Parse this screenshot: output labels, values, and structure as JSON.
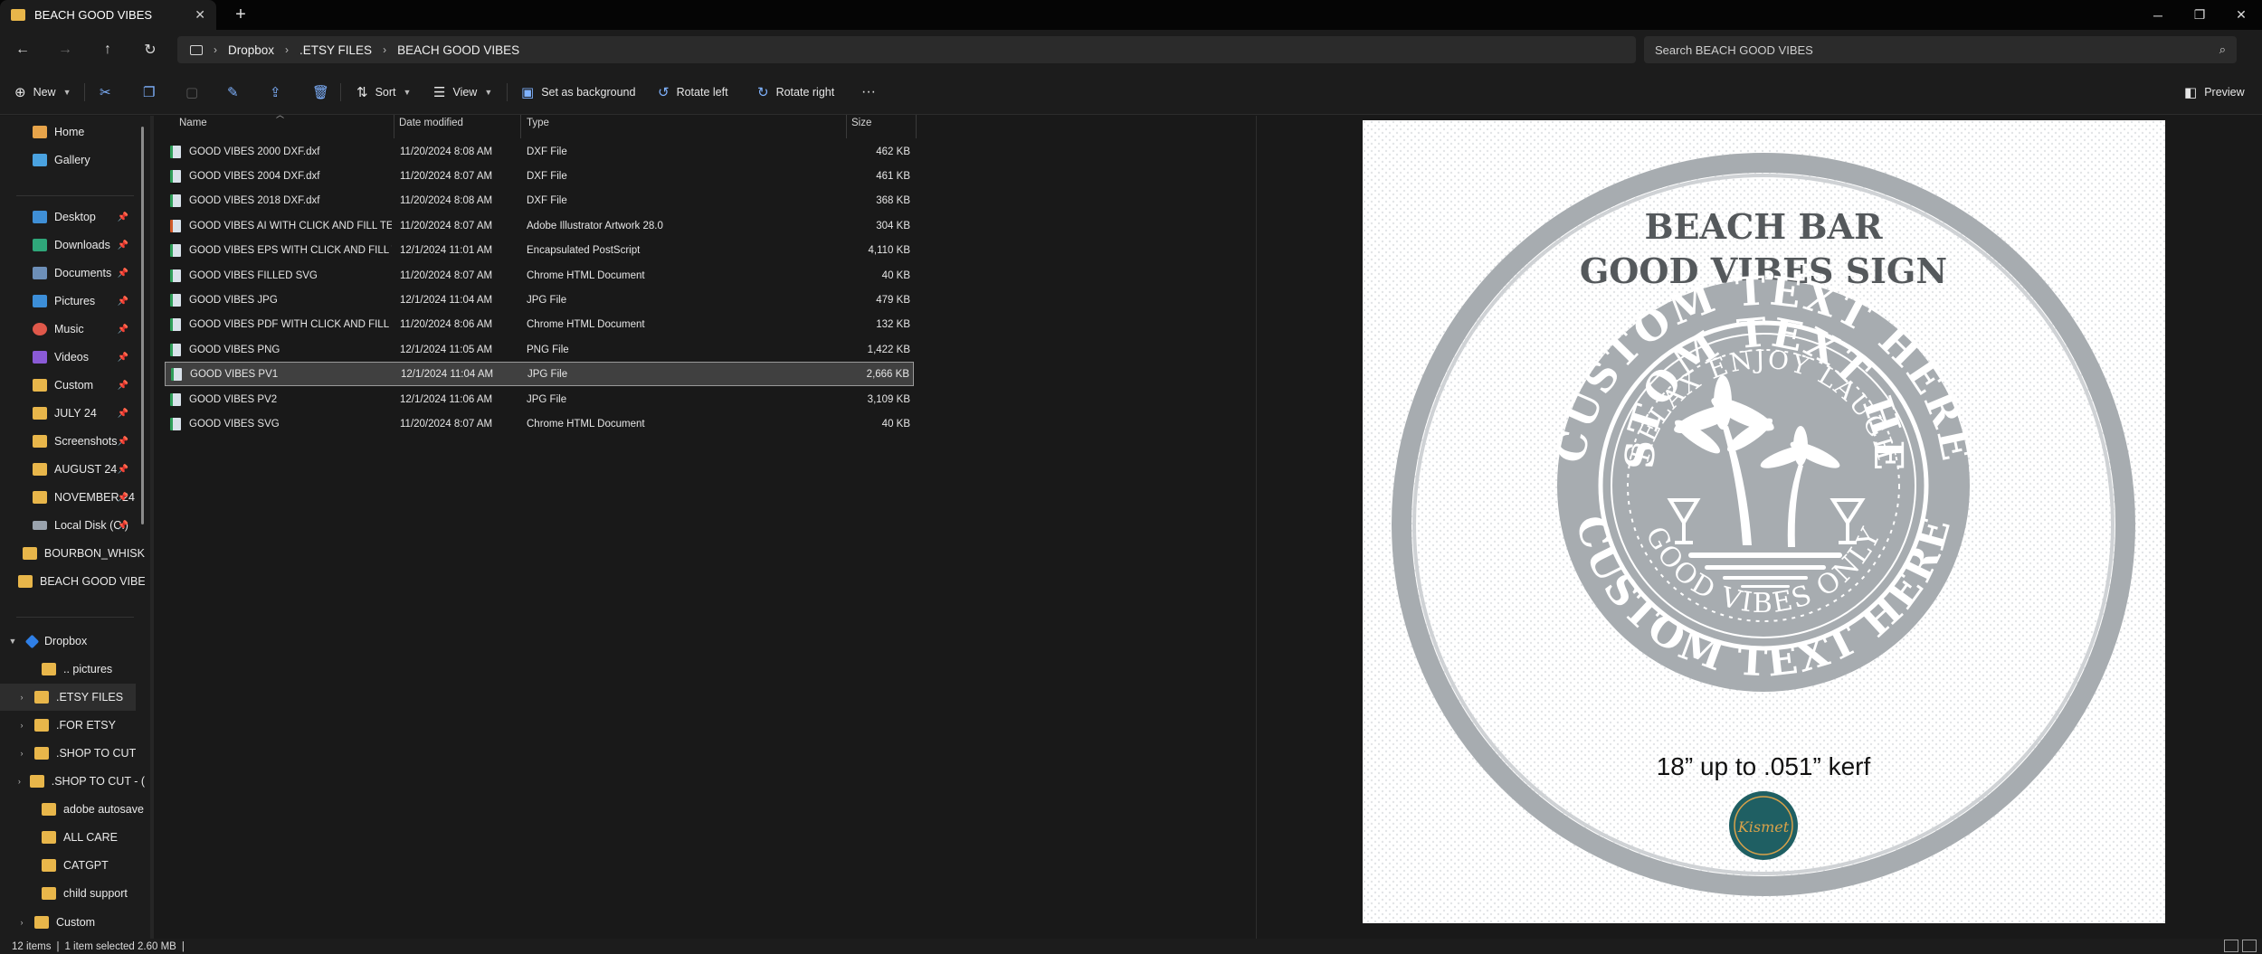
{
  "window": {
    "tab_title": "BEACH GOOD VIBES",
    "tab_close": "✕",
    "new_tab": "+"
  },
  "address": {
    "segments": [
      "Dropbox",
      ".ETSY FILES",
      "BEACH GOOD VIBES"
    ],
    "separator": "›"
  },
  "search": {
    "placeholder": "Search BEACH GOOD VIBES"
  },
  "toolbar": {
    "new_label": "New",
    "sort_label": "Sort",
    "view_label": "View",
    "set_background_label": "Set as background",
    "rotate_left_label": "Rotate left",
    "rotate_right_label": "Rotate right",
    "more_label": "···",
    "preview_label": "Preview"
  },
  "sidebar": {
    "items": [
      {
        "label": "Home"
      },
      {
        "label": "Gallery"
      },
      {
        "label": "Desktop"
      },
      {
        "label": "Downloads"
      },
      {
        "label": "Documents"
      },
      {
        "label": "Pictures"
      },
      {
        "label": "Music"
      },
      {
        "label": "Videos"
      },
      {
        "label": "Custom"
      },
      {
        "label": "JULY 24"
      },
      {
        "label": "Screenshots"
      },
      {
        "label": "AUGUST 24"
      },
      {
        "label": "NOVEMBER 24"
      },
      {
        "label": "Local Disk (C:)"
      },
      {
        "label": "BOURBON_WHISK"
      },
      {
        "label": "BEACH GOOD VIBE"
      }
    ],
    "dropbox": {
      "label": "Dropbox",
      "children": [
        {
          "label": ".. pictures"
        },
        {
          "label": ".ETSY FILES"
        },
        {
          "label": ".FOR ETSY"
        },
        {
          "label": ".SHOP TO CUT"
        },
        {
          "label": ".SHOP TO CUT - ("
        },
        {
          "label": "adobe autosave"
        },
        {
          "label": "ALL CARE"
        },
        {
          "label": "CATGPT"
        },
        {
          "label": "child support"
        },
        {
          "label": "Custom"
        }
      ]
    }
  },
  "columns": {
    "name": "Name",
    "date": "Date modified",
    "type": "Type",
    "size": "Size"
  },
  "files": [
    {
      "name": "GOOD VIBES 2000 DXF.dxf",
      "date": "11/20/2024 8:08 AM",
      "type": "DXF File",
      "size": "462 KB"
    },
    {
      "name": "GOOD VIBES 2004 DXF.dxf",
      "date": "11/20/2024 8:07 AM",
      "type": "DXF File",
      "size": "461 KB"
    },
    {
      "name": "GOOD VIBES 2018 DXF.dxf",
      "date": "11/20/2024 8:08 AM",
      "type": "DXF File",
      "size": "368 KB"
    },
    {
      "name": "GOOD VIBES AI WITH CLICK AND FILL TE...",
      "date": "11/20/2024 8:07 AM",
      "type": "Adobe Illustrator Artwork 28.0",
      "size": "304 KB"
    },
    {
      "name": "GOOD VIBES EPS WITH CLICK AND FILL T...",
      "date": "12/1/2024 11:01 AM",
      "type": "Encapsulated PostScript",
      "size": "4,110 KB"
    },
    {
      "name": "GOOD VIBES FILLED SVG",
      "date": "11/20/2024 8:07 AM",
      "type": "Chrome HTML Document",
      "size": "40 KB"
    },
    {
      "name": "GOOD VIBES JPG",
      "date": "12/1/2024 11:04 AM",
      "type": "JPG File",
      "size": "479 KB"
    },
    {
      "name": "GOOD VIBES PDF WITH CLICK AND FILL ...",
      "date": "11/20/2024 8:06 AM",
      "type": "Chrome HTML Document",
      "size": "132 KB"
    },
    {
      "name": "GOOD VIBES PNG",
      "date": "12/1/2024 11:05 AM",
      "type": "PNG File",
      "size": "1,422 KB"
    },
    {
      "name": "GOOD VIBES PV1",
      "date": "12/1/2024 11:04 AM",
      "type": "JPG File",
      "size": "2,666 KB"
    },
    {
      "name": "GOOD VIBES PV2",
      "date": "12/1/2024 11:06 AM",
      "type": "JPG File",
      "size": "3,109 KB"
    },
    {
      "name": "GOOD VIBES SVG",
      "date": "11/20/2024 8:07 AM",
      "type": "Chrome HTML Document",
      "size": "40 KB"
    }
  ],
  "preview": {
    "title_line1": "BEACH BAR",
    "title_line2": "GOOD VIBES SIGN",
    "ring_top": "CUSTOM TEXT HERE",
    "ring_bottom": "CUSTOM TEXT HERE",
    "arc_top": "RELAX  ENJOY  LAUGH",
    "arc_bottom": "GOOD VIBES ONLY",
    "spec": "18” up to .051” kerf",
    "logo_text": "Kismet"
  },
  "status": {
    "item_count": "12 items",
    "selection": "1 item selected  2.60 MB",
    "divider": "|"
  },
  "colors": {
    "accent": "#7fb2ff",
    "folder": "#e8b64a",
    "sign_gray": "#a7acb0"
  }
}
